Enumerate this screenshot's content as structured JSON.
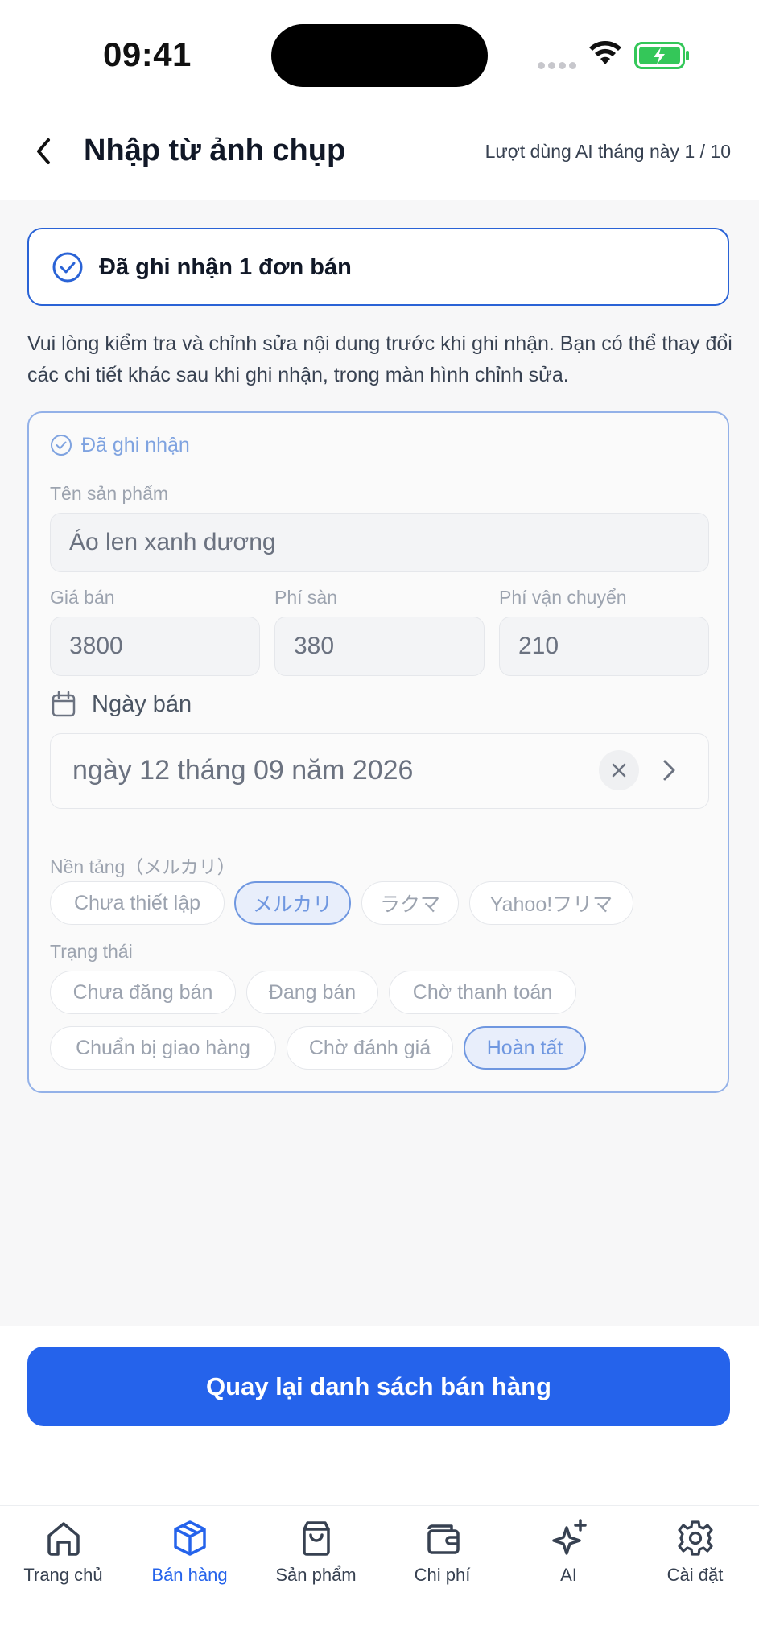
{
  "status_bar": {
    "time": "09:41"
  },
  "header": {
    "title": "Nhập từ ảnh chụp",
    "usage": "Lượt dùng AI tháng này 1 / 10"
  },
  "alert": {
    "text": "Đã ghi nhận 1 đơn bán"
  },
  "description": "Vui lòng kiểm tra và chỉnh sửa nội dung trước khi ghi nhận. Bạn có thể thay đổi các chi tiết khác sau khi ghi nhận, trong màn hình chỉnh sửa.",
  "card": {
    "status": "Đã ghi nhận",
    "product_name_label": "Tên sản phẩm",
    "product_name_value": "Áo len xanh dương",
    "price_label": "Giá bán",
    "price_value": "3800",
    "fee_label": "Phí sàn",
    "fee_value": "380",
    "shipping_label": "Phí vận chuyển",
    "shipping_value": "210",
    "date_label": "Ngày bán",
    "date_value": "ngày 12 tháng 09 năm 2026",
    "platform_label": "Nền tảng（メルカリ）",
    "platforms": [
      {
        "label": "Chưa thiết lập",
        "selected": false
      },
      {
        "label": "メルカリ",
        "selected": true
      },
      {
        "label": "ラクマ",
        "selected": false
      },
      {
        "label": "Yahoo!フリマ",
        "selected": false
      }
    ],
    "status_label": "Trạng thái",
    "statuses": [
      {
        "label": "Chưa đăng bán",
        "selected": false
      },
      {
        "label": "Đang bán",
        "selected": false
      },
      {
        "label": "Chờ thanh toán",
        "selected": false
      },
      {
        "label": "Chuẩn bị giao hàng",
        "selected": false
      },
      {
        "label": "Chờ đánh giá",
        "selected": false
      },
      {
        "label": "Hoàn tất",
        "selected": true
      }
    ]
  },
  "primary_button": "Quay lại danh sách bán hàng",
  "tabs": [
    {
      "label": "Trang chủ",
      "icon": "home-icon",
      "active": false
    },
    {
      "label": "Bán hàng",
      "icon": "box-icon",
      "active": true
    },
    {
      "label": "Sản phẩm",
      "icon": "bag-icon",
      "active": false
    },
    {
      "label": "Chi phí",
      "icon": "wallet-icon",
      "active": false
    },
    {
      "label": "AI",
      "icon": "sparkle-icon",
      "active": false
    },
    {
      "label": "Cài đặt",
      "icon": "gear-icon",
      "active": false
    }
  ],
  "colors": {
    "accent": "#2563eb",
    "selected_chip": "#6f97e0",
    "battery": "#34c759"
  }
}
